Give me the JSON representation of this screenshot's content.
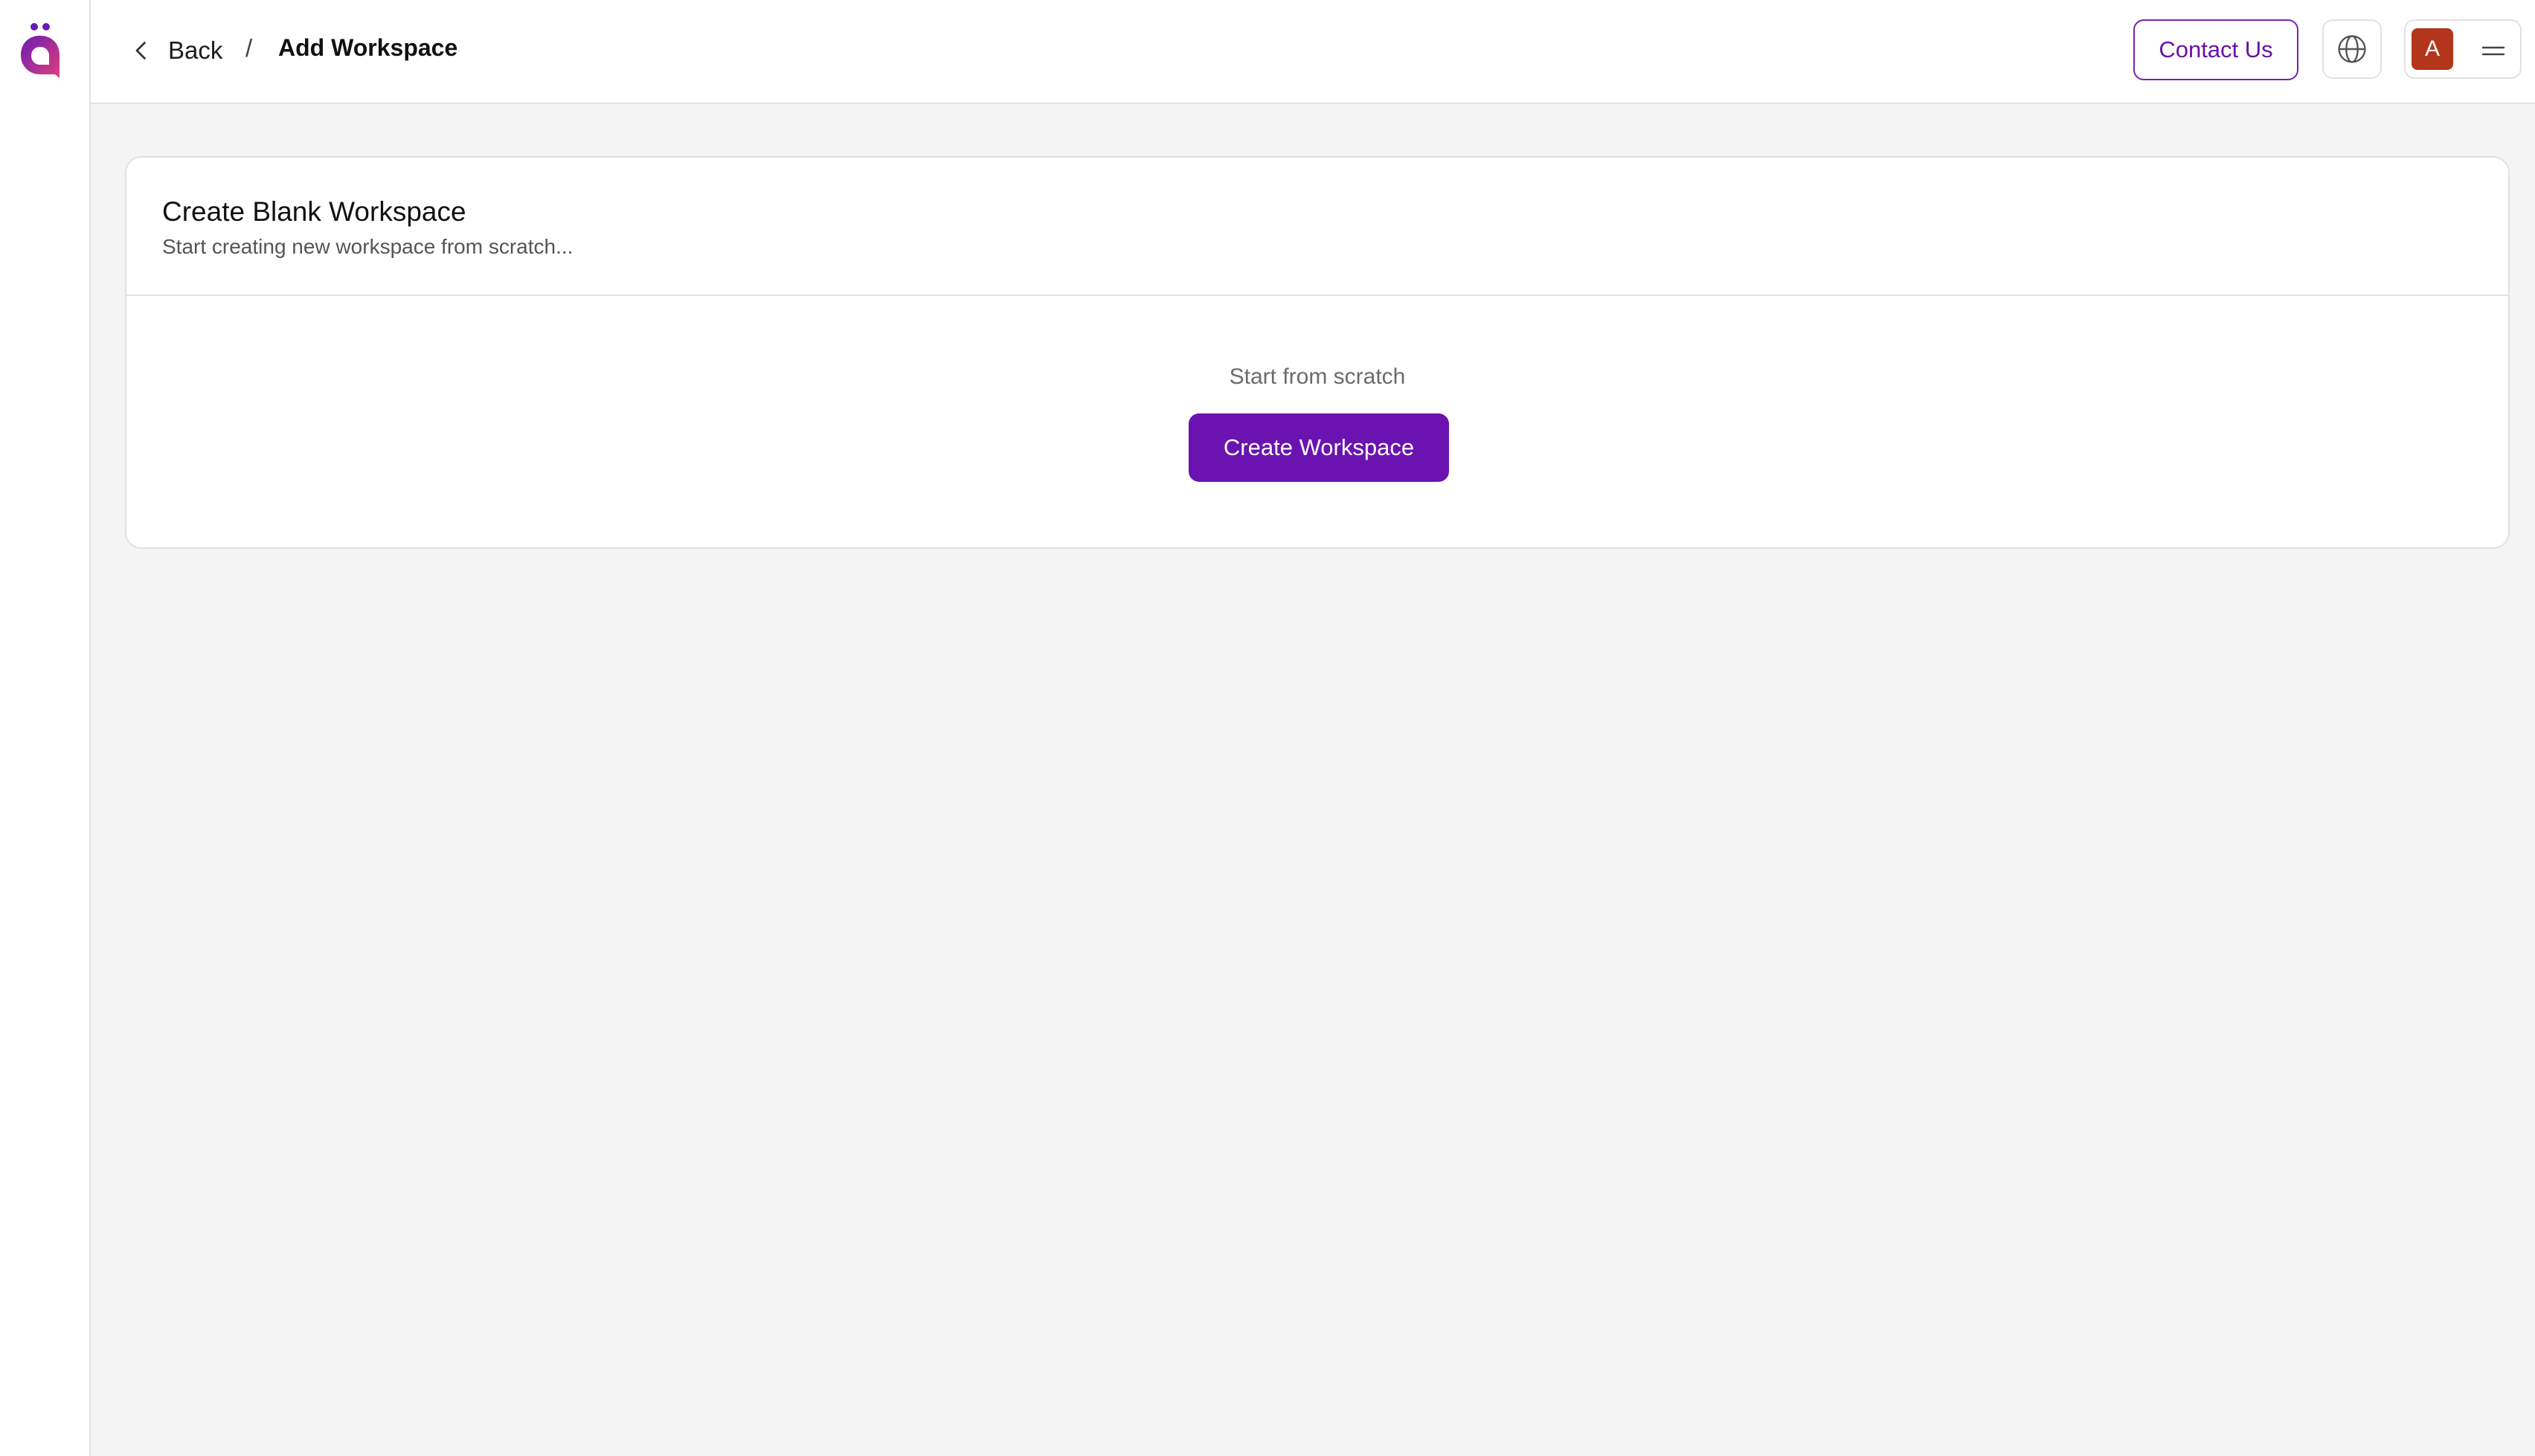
{
  "app": {
    "logo_icon": "app-logo-icon",
    "colors": {
      "accent": "#6b13b0",
      "avatar": "#b3361c",
      "background": "#f4f4f4"
    }
  },
  "header": {
    "back_label": "Back",
    "separator": "/",
    "current_page": "Add Workspace",
    "contact_label": "Contact Us",
    "language_icon": "globe-icon",
    "user_initial": "A",
    "menu_icon": "hamburger-icon"
  },
  "card": {
    "title": "Create Blank Workspace",
    "subtitle": "Start creating new workspace from scratch...",
    "scratch_label": "Start from scratch",
    "create_button_label": "Create Workspace"
  }
}
